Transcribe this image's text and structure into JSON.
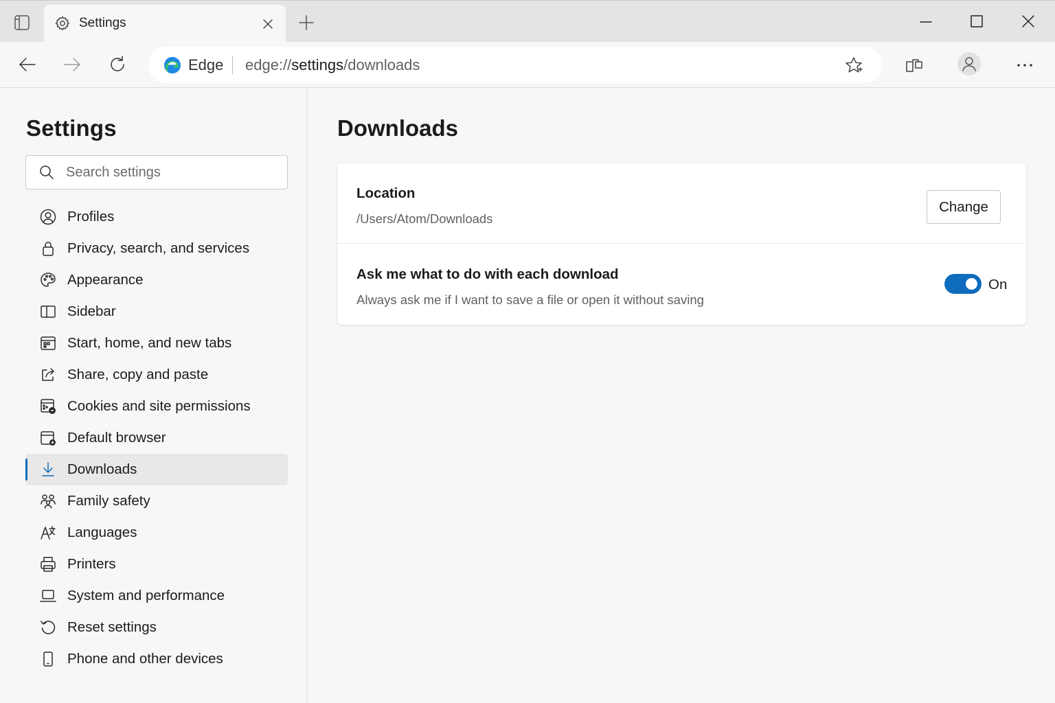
{
  "browser": {
    "tab_title": "Settings",
    "address": {
      "brand": "Edge",
      "url_scheme": "edge://",
      "url_host": "settings",
      "url_path": "/downloads"
    }
  },
  "sidebar": {
    "title": "Settings",
    "search_placeholder": "Search settings",
    "items": [
      {
        "label": "Profiles",
        "icon": "profile-icon"
      },
      {
        "label": "Privacy, search, and services",
        "icon": "lock-icon"
      },
      {
        "label": "Appearance",
        "icon": "palette-icon"
      },
      {
        "label": "Sidebar",
        "icon": "sidebar-icon"
      },
      {
        "label": "Start, home, and new tabs",
        "icon": "calendar-grid-icon"
      },
      {
        "label": "Share, copy and paste",
        "icon": "share-icon"
      },
      {
        "label": "Cookies and site permissions",
        "icon": "cookies-icon"
      },
      {
        "label": "Default browser",
        "icon": "default-browser-icon"
      },
      {
        "label": "Downloads",
        "icon": "download-icon",
        "active": true
      },
      {
        "label": "Family safety",
        "icon": "family-icon"
      },
      {
        "label": "Languages",
        "icon": "languages-icon"
      },
      {
        "label": "Printers",
        "icon": "printer-icon"
      },
      {
        "label": "System and performance",
        "icon": "laptop-icon"
      },
      {
        "label": "Reset settings",
        "icon": "reset-icon"
      },
      {
        "label": "Phone and other devices",
        "icon": "phone-icon"
      }
    ]
  },
  "main": {
    "title": "Downloads",
    "location": {
      "title": "Location",
      "path": "/Users/Atom/Downloads",
      "button_label": "Change"
    },
    "ask_download": {
      "title": "Ask me what to do with each download",
      "description": "Always ask me if I want to save a file or open it without saving",
      "toggle_state": "On",
      "enabled": true
    }
  },
  "colors": {
    "accent": "#0f6cbd",
    "active_item_bg": "#e8e8e8",
    "page_bg": "#f7f7f7"
  }
}
